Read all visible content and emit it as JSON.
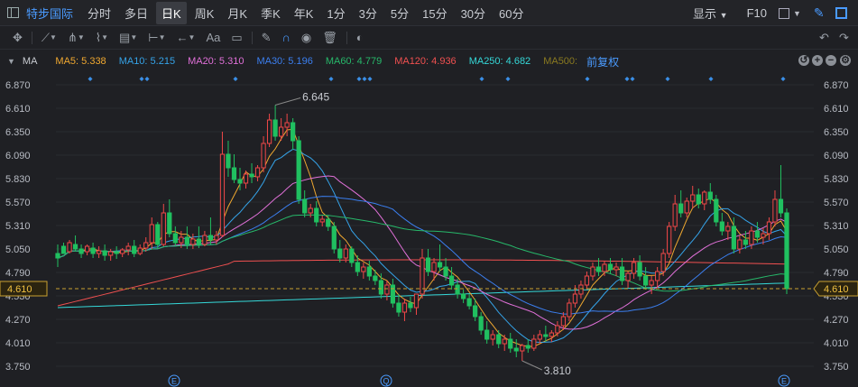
{
  "header": {
    "stock_name": "特步国际",
    "tabs": [
      "分时",
      "多日",
      "日K",
      "周K",
      "月K",
      "季K",
      "年K",
      "1分",
      "3分",
      "5分",
      "15分",
      "30分",
      "60分"
    ],
    "active_tab": "日K",
    "display_label": "显示",
    "f10_label": "F10"
  },
  "toolbar": {
    "text_tool_label": "Aa",
    "icons": [
      "crosshair-icon",
      "line-icon",
      "channel-icon",
      "wave-icon",
      "fib-icon",
      "measure-icon",
      "arrow-left-icon",
      "text-icon",
      "comment-icon",
      "eraser-icon",
      "magnet-icon",
      "eye-icon",
      "trash-icon",
      "toggle-icon"
    ]
  },
  "legend": {
    "main_label": "MA",
    "items": [
      {
        "text": "MA5: 5.338",
        "color": "#f0a830"
      },
      {
        "text": "MA10: 5.215",
        "color": "#35a3e8"
      },
      {
        "text": "MA20: 5.310",
        "color": "#e070d8"
      },
      {
        "text": "MA30: 5.196",
        "color": "#3b7ff0"
      },
      {
        "text": "MA60: 4.779",
        "color": "#27b86a"
      },
      {
        "text": "MA120: 4.936",
        "color": "#f05050"
      },
      {
        "text": "MA250: 4.682",
        "color": "#35d8d8"
      },
      {
        "text": "MA500:",
        "color": "#8a7a20"
      }
    ],
    "adjust_label": "前复权"
  },
  "chart_data": {
    "type": "candlestick",
    "y_ticks": [
      "6.870",
      "6.610",
      "6.350",
      "6.090",
      "5.830",
      "5.570",
      "5.310",
      "5.050",
      "4.790",
      "4.530",
      "4.270",
      "4.010",
      "3.750"
    ],
    "ylim": [
      3.7,
      6.95
    ],
    "current_price": "4.610",
    "annotations": {
      "high": "6.645",
      "low": "3.810"
    },
    "event_markers": [
      "E",
      "Q",
      "E"
    ],
    "colors": {
      "up": "#f04848",
      "down": "#20c060",
      "bg": "#1f2024"
    },
    "candles": [
      [
        5.0,
        5.1,
        4.95,
        4.85
      ],
      [
        5.08,
        5.12,
        5.0,
        5.0
      ],
      [
        5.02,
        5.15,
        5.12,
        5.0
      ],
      [
        5.1,
        5.2,
        5.05,
        5.02
      ],
      [
        5.05,
        5.1,
        5.0,
        4.95
      ],
      [
        5.02,
        5.1,
        5.08,
        4.98
      ],
      [
        5.06,
        5.12,
        5.0,
        4.95
      ],
      [
        5.0,
        5.08,
        5.03,
        4.95
      ],
      [
        5.03,
        5.1,
        4.98,
        4.92
      ],
      [
        4.98,
        5.05,
        5.02,
        4.92
      ],
      [
        5.02,
        5.08,
        5.0,
        4.94
      ],
      [
        5.0,
        5.06,
        5.04,
        4.96
      ],
      [
        5.04,
        5.12,
        5.08,
        4.98
      ],
      [
        5.08,
        5.15,
        5.0,
        4.96
      ],
      [
        5.0,
        5.1,
        5.06,
        4.98
      ],
      [
        5.06,
        5.18,
        5.12,
        5.02
      ],
      [
        5.12,
        5.4,
        5.32,
        5.05
      ],
      [
        5.32,
        5.35,
        5.1,
        5.05
      ],
      [
        5.1,
        5.55,
        5.45,
        5.08
      ],
      [
        5.45,
        5.6,
        5.22,
        5.18
      ],
      [
        5.22,
        5.3,
        5.12,
        5.08
      ],
      [
        5.12,
        5.25,
        5.18,
        5.06
      ],
      [
        5.18,
        5.3,
        5.1,
        5.05
      ],
      [
        5.1,
        5.22,
        5.16,
        5.05
      ],
      [
        5.16,
        5.3,
        5.1,
        5.06
      ],
      [
        5.1,
        5.25,
        5.2,
        5.08
      ],
      [
        5.2,
        5.4,
        5.15,
        5.1
      ],
      [
        5.15,
        5.25,
        5.2,
        5.1
      ],
      [
        5.2,
        6.35,
        6.1,
        5.18
      ],
      [
        6.1,
        6.25,
        5.95,
        5.85
      ],
      [
        5.95,
        6.1,
        5.82,
        5.78
      ],
      [
        5.82,
        5.95,
        5.78,
        5.7
      ],
      [
        5.78,
        5.92,
        5.88,
        5.72
      ],
      [
        5.88,
        6.0,
        5.85,
        5.78
      ],
      [
        5.85,
        5.98,
        5.95,
        5.8
      ],
      [
        5.95,
        6.3,
        6.22,
        5.9
      ],
      [
        6.22,
        6.55,
        6.48,
        6.18
      ],
      [
        6.48,
        6.645,
        6.3,
        6.25
      ],
      [
        6.3,
        6.5,
        6.4,
        6.25
      ],
      [
        6.4,
        6.55,
        6.45,
        6.3
      ],
      [
        6.45,
        6.5,
        6.25,
        6.15
      ],
      [
        6.25,
        6.3,
        5.6,
        5.55
      ],
      [
        5.6,
        5.7,
        5.45,
        5.4
      ],
      [
        5.45,
        5.55,
        5.5,
        5.4
      ],
      [
        5.5,
        5.58,
        5.35,
        5.3
      ],
      [
        5.35,
        5.42,
        5.38,
        5.3
      ],
      [
        5.38,
        5.42,
        5.3,
        5.25
      ],
      [
        5.3,
        5.35,
        5.05,
        5.0
      ],
      [
        5.05,
        5.15,
        4.95,
        4.9
      ],
      [
        4.95,
        5.1,
        5.05,
        4.9
      ],
      [
        5.05,
        5.08,
        4.9,
        4.85
      ],
      [
        4.9,
        4.98,
        4.8,
        4.75
      ],
      [
        4.8,
        4.9,
        4.85,
        4.72
      ],
      [
        4.85,
        4.92,
        4.75,
        4.7
      ],
      [
        4.75,
        4.82,
        4.7,
        4.65
      ],
      [
        4.7,
        4.78,
        4.55,
        4.5
      ],
      [
        4.55,
        4.7,
        4.65,
        4.48
      ],
      [
        4.65,
        4.72,
        4.45,
        4.4
      ],
      [
        4.45,
        4.55,
        4.35,
        4.3
      ],
      [
        4.35,
        4.5,
        4.45,
        4.25
      ],
      [
        4.45,
        4.52,
        4.4,
        4.35
      ],
      [
        4.4,
        4.45,
        4.55,
        4.32
      ],
      [
        4.55,
        5.05,
        4.95,
        4.5
      ],
      [
        4.95,
        5.05,
        4.8,
        4.75
      ],
      [
        4.8,
        4.95,
        4.9,
        4.7
      ],
      [
        4.9,
        5.1,
        4.85,
        4.8
      ],
      [
        4.85,
        4.95,
        4.75,
        4.7
      ],
      [
        4.75,
        4.85,
        4.65,
        4.6
      ],
      [
        4.65,
        4.72,
        4.55,
        4.5
      ],
      [
        4.55,
        4.6,
        4.5,
        4.45
      ],
      [
        4.5,
        4.55,
        4.42,
        4.38
      ],
      [
        4.42,
        4.5,
        4.3,
        4.25
      ],
      [
        4.3,
        4.35,
        4.15,
        4.1
      ],
      [
        4.15,
        4.25,
        4.05,
        4.0
      ],
      [
        4.05,
        4.15,
        4.1,
        3.98
      ],
      [
        4.1,
        4.15,
        4.0,
        3.95
      ],
      [
        4.0,
        4.1,
        4.05,
        3.92
      ],
      [
        4.05,
        4.12,
        3.95,
        3.9
      ],
      [
        3.95,
        4.05,
        3.92,
        3.85
      ],
      [
        3.92,
        4.0,
        3.98,
        3.81
      ],
      [
        3.98,
        4.05,
        3.95,
        3.9
      ],
      [
        3.95,
        4.1,
        4.05,
        3.92
      ],
      [
        4.05,
        4.15,
        4.1,
        4.0
      ],
      [
        4.1,
        4.2,
        4.08,
        4.02
      ],
      [
        4.08,
        4.15,
        4.12,
        4.02
      ],
      [
        4.12,
        4.25,
        4.2,
        4.08
      ],
      [
        4.2,
        4.35,
        4.3,
        4.15
      ],
      [
        4.3,
        4.5,
        4.45,
        4.25
      ],
      [
        4.45,
        4.65,
        4.55,
        4.4
      ],
      [
        4.55,
        4.7,
        4.65,
        4.5
      ],
      [
        4.65,
        4.8,
        4.75,
        4.6
      ],
      [
        4.75,
        4.9,
        4.85,
        4.7
      ],
      [
        4.85,
        4.95,
        4.8,
        4.75
      ],
      [
        4.8,
        4.92,
        4.88,
        4.75
      ],
      [
        4.88,
        4.95,
        4.82,
        4.78
      ],
      [
        4.82,
        4.9,
        4.85,
        4.75
      ],
      [
        4.85,
        4.95,
        4.7,
        4.65
      ],
      [
        4.7,
        4.8,
        4.78,
        4.62
      ],
      [
        4.78,
        4.95,
        4.9,
        4.72
      ],
      [
        4.9,
        4.98,
        4.75,
        4.7
      ],
      [
        4.75,
        4.85,
        4.65,
        4.6
      ],
      [
        4.65,
        4.75,
        4.7,
        4.55
      ],
      [
        4.7,
        4.85,
        4.8,
        4.62
      ],
      [
        4.8,
        5.05,
        5.0,
        4.75
      ],
      [
        5.0,
        5.35,
        5.3,
        4.95
      ],
      [
        5.3,
        5.65,
        5.55,
        5.25
      ],
      [
        5.55,
        5.7,
        5.45,
        5.4
      ],
      [
        5.45,
        5.62,
        5.58,
        5.4
      ],
      [
        5.58,
        5.75,
        5.65,
        5.5
      ],
      [
        5.65,
        5.72,
        5.55,
        5.5
      ],
      [
        5.55,
        5.7,
        5.68,
        5.48
      ],
      [
        5.68,
        5.78,
        5.6,
        5.55
      ],
      [
        5.6,
        5.65,
        5.35,
        5.3
      ],
      [
        5.35,
        5.45,
        5.25,
        5.2
      ],
      [
        5.25,
        5.35,
        5.3,
        5.15
      ],
      [
        5.3,
        5.4,
        5.05,
        5.0
      ],
      [
        5.05,
        5.2,
        5.15,
        5.0
      ],
      [
        5.15,
        5.25,
        5.1,
        5.05
      ],
      [
        5.1,
        5.3,
        5.25,
        5.05
      ],
      [
        5.25,
        5.35,
        5.18,
        5.12
      ],
      [
        5.18,
        5.28,
        5.22,
        5.1
      ],
      [
        5.22,
        5.4,
        5.35,
        5.15
      ],
      [
        5.35,
        5.7,
        5.6,
        5.3
      ],
      [
        5.6,
        5.98,
        5.45,
        5.4
      ],
      [
        5.45,
        5.5,
        4.61,
        4.55
      ]
    ]
  }
}
